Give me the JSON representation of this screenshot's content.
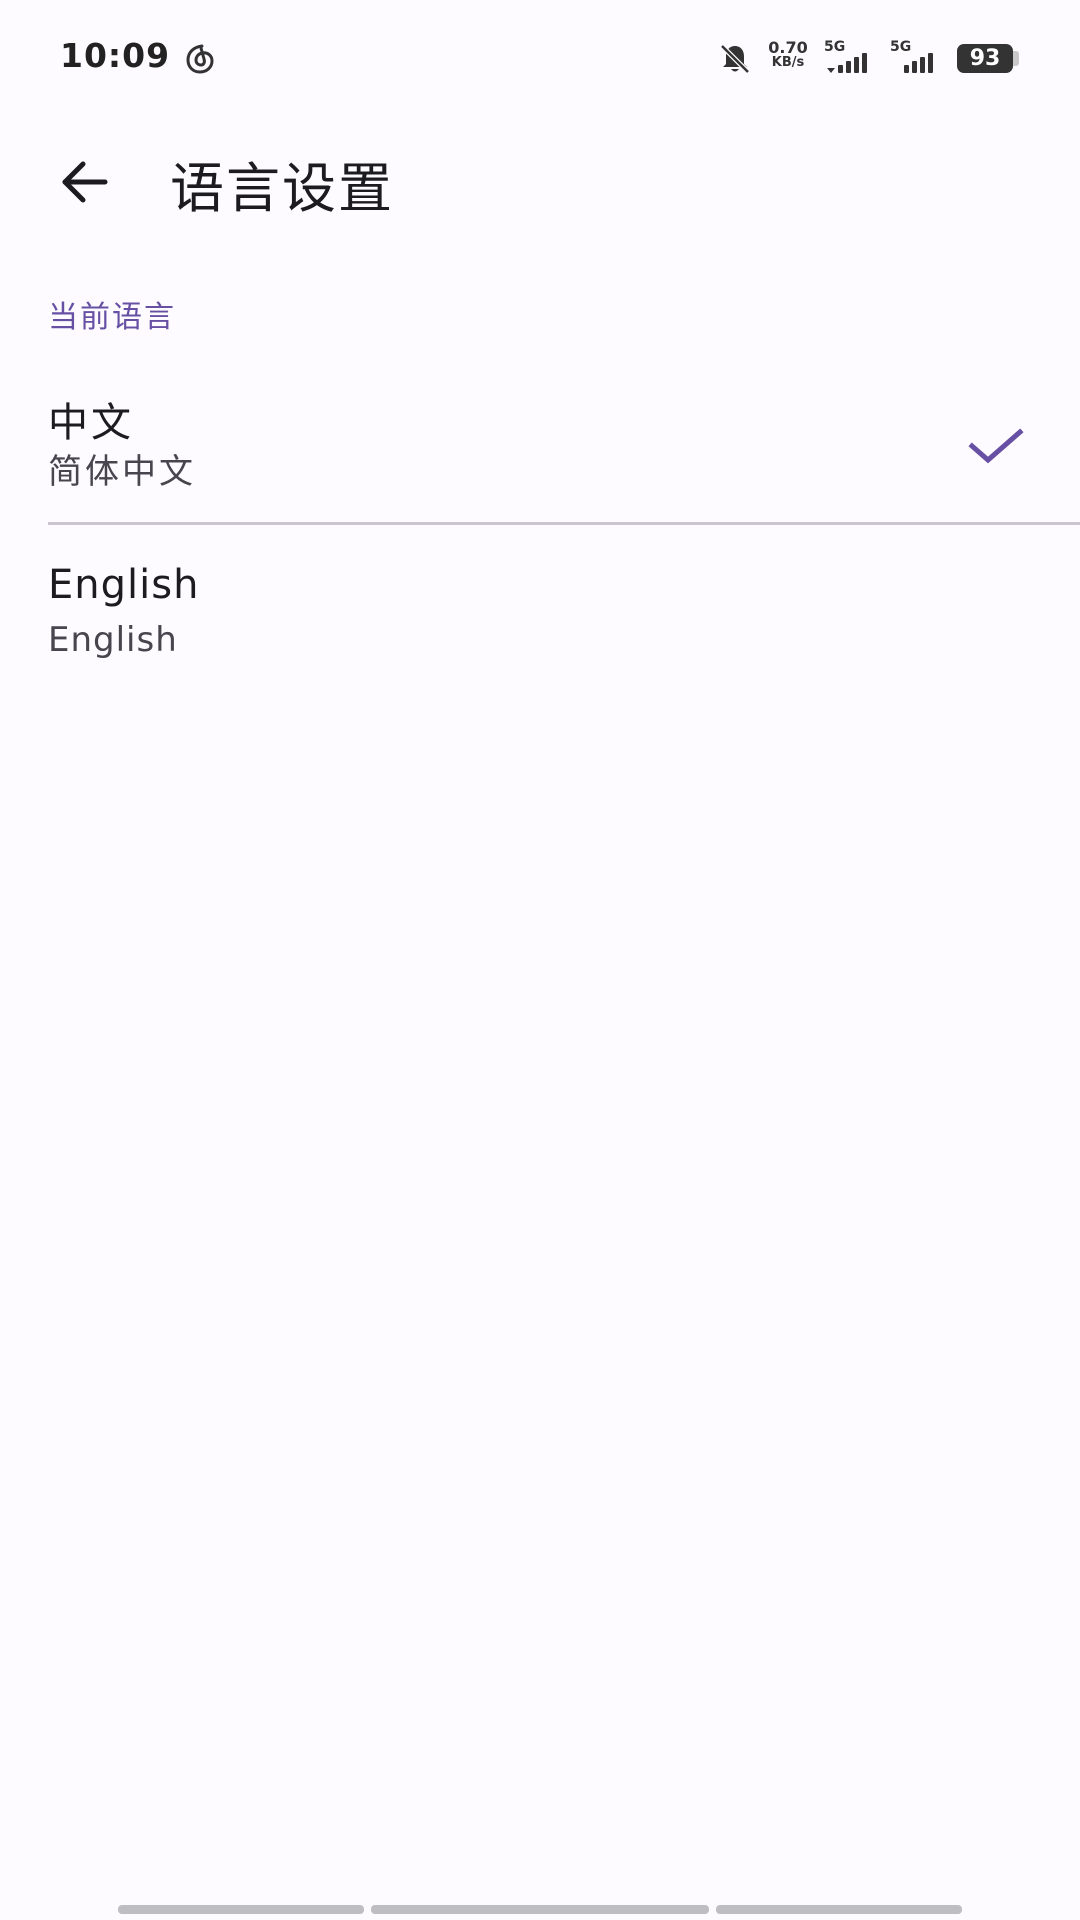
{
  "status_bar": {
    "time": "10:09",
    "net_speed_value": "0.70",
    "net_speed_unit": "KB/s",
    "sim1_label": "5G",
    "sim2_label": "5G",
    "battery_level": "93",
    "icons": [
      "netease-music-icon",
      "bell-off-icon",
      "signal-icon",
      "battery-icon"
    ]
  },
  "app_bar": {
    "back_icon": "arrow-left-icon",
    "title": "语言设置"
  },
  "section": {
    "header": "当前语言"
  },
  "languages": [
    {
      "title": "中文",
      "subtitle": "简体中文",
      "selected": true
    },
    {
      "title": "English",
      "subtitle": "English",
      "selected": false
    }
  ],
  "colors": {
    "accent": "#6750a4",
    "background": "#fdfbff",
    "divider": "#cac4d0"
  }
}
